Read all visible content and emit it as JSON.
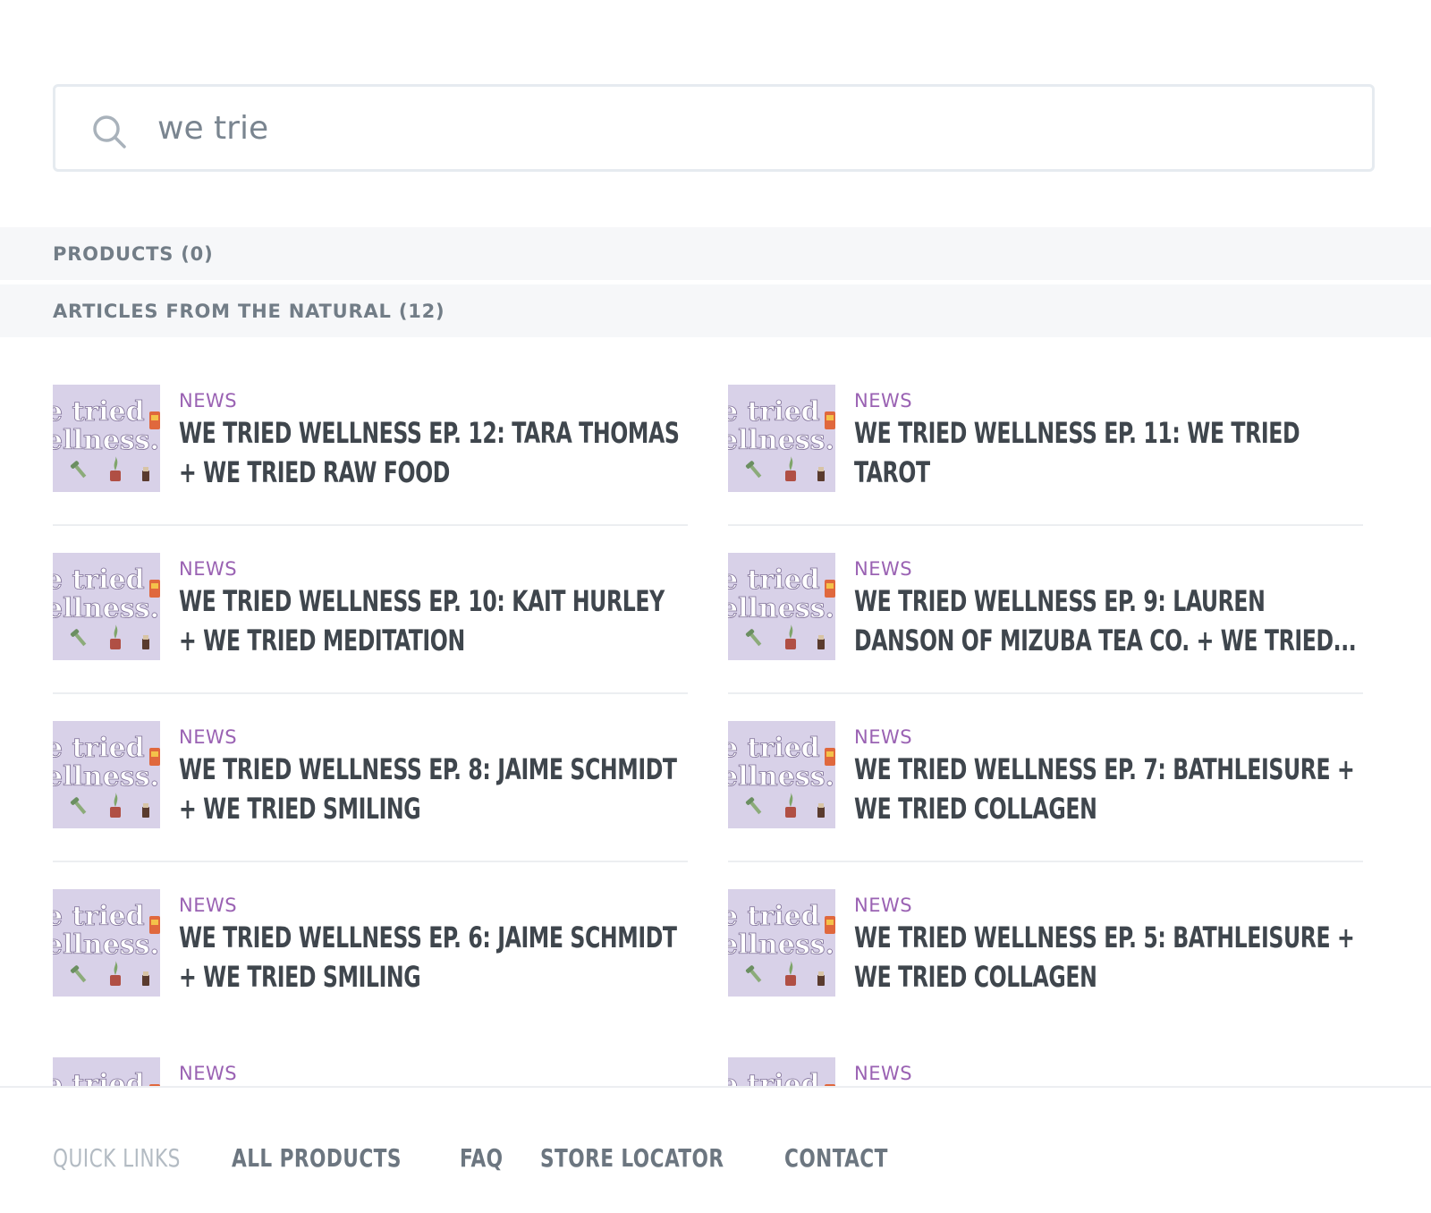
{
  "search": {
    "value": "we trie",
    "placeholder": ""
  },
  "sections": {
    "products": "PRODUCTS (0)",
    "articles": "ARTICLES FROM THE NATURAL (12)"
  },
  "thumbnail": {
    "line1": "e tried",
    "line2": "ellness."
  },
  "articles": [
    {
      "category": "NEWS",
      "title": "WE TRIED WELLNESS EP. 12: TARA THOMAS + WE TRIED RAW FOOD"
    },
    {
      "category": "NEWS",
      "title": "WE TRIED WELLNESS EP. 11: WE TRIED TAROT"
    },
    {
      "category": "NEWS",
      "title": "WE TRIED WELLNESS EP. 10: KAIT HURLEY + WE TRIED MEDITATION"
    },
    {
      "category": "NEWS",
      "title": "WE TRIED WELLNESS EP. 9: LAUREN DANSON OF MIZUBA TEA CO. + WE TRIED..."
    },
    {
      "category": "NEWS",
      "title": "WE TRIED WELLNESS EP. 8: JAIME SCHMIDT + WE TRIED SMILING"
    },
    {
      "category": "NEWS",
      "title": "WE TRIED WELLNESS EP. 7: BATHLEISURE + WE TRIED COLLAGEN"
    },
    {
      "category": "NEWS",
      "title": "WE TRIED WELLNESS EP. 6: JAIME SCHMIDT + WE TRIED SMILING"
    },
    {
      "category": "NEWS",
      "title": "WE TRIED WELLNESS EP. 5: BATHLEISURE + WE TRIED COLLAGEN"
    },
    {
      "category": "NEWS",
      "title": ""
    },
    {
      "category": "NEWS",
      "title": ""
    }
  ],
  "footer": {
    "quick_links": "QUICK LINKS",
    "links": [
      "ALL PRODUCTS",
      "FAQ",
      "STORE LOCATOR",
      "CONTACT"
    ]
  },
  "colors": {
    "accent": "#9a62b3",
    "text": "#3f464d",
    "section_bg": "#f6f7f9",
    "thumb_bg": "#d8d1e8"
  },
  "icons": {
    "search": "search-icon",
    "thumbnail": "we-tried-wellness-thumbnail"
  }
}
